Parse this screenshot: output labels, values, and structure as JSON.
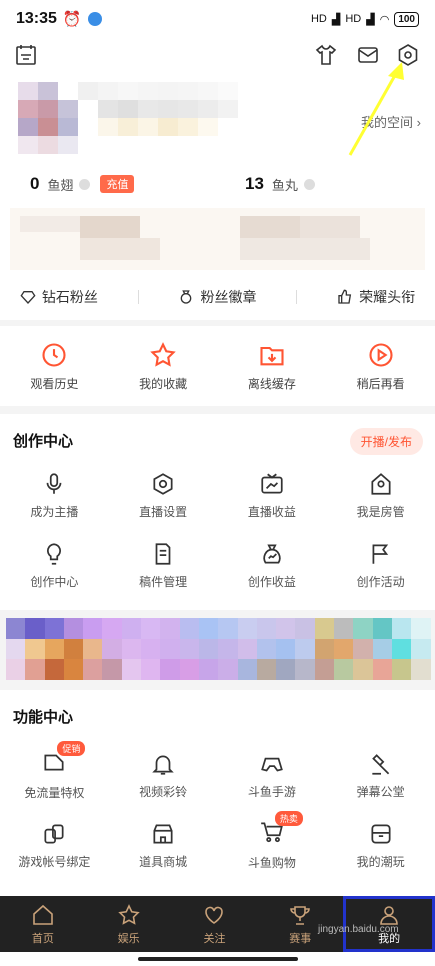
{
  "status": {
    "time": "13:35",
    "signal1": "HD",
    "signal2": "HD",
    "battery": "100"
  },
  "header": {
    "myspace": "我的空间"
  },
  "counts": {
    "yuchi_num": "0",
    "yuchi_label": "鱼翅",
    "recharge": "充值",
    "yuwan_num": "13",
    "yuwan_label": "鱼丸"
  },
  "fans": {
    "diamond": "钻石粉丝",
    "badge": "粉丝徽章",
    "honor": "荣耀头衔"
  },
  "quick": [
    {
      "label": "观看历史"
    },
    {
      "label": "我的收藏"
    },
    {
      "label": "离线缓存"
    },
    {
      "label": "稍后再看"
    }
  ],
  "creation": {
    "title": "创作中心",
    "live_button": "开播/发布",
    "items": [
      {
        "label": "成为主播"
      },
      {
        "label": "直播设置"
      },
      {
        "label": "直播收益"
      },
      {
        "label": "我是房管"
      },
      {
        "label": "创作中心"
      },
      {
        "label": "稿件管理"
      },
      {
        "label": "创作收益"
      },
      {
        "label": "创作活动"
      }
    ]
  },
  "features": {
    "title": "功能中心",
    "items": [
      {
        "label": "免流量特权",
        "badge": "促销"
      },
      {
        "label": "视频彩铃"
      },
      {
        "label": "斗鱼手游"
      },
      {
        "label": "弹幕公堂"
      },
      {
        "label": "游戏帐号绑定"
      },
      {
        "label": "道具商城"
      },
      {
        "label": "斗鱼购物",
        "badge": "热卖"
      },
      {
        "label": "我的潮玩"
      }
    ]
  },
  "tabs": [
    {
      "label": "首页"
    },
    {
      "label": "娱乐"
    },
    {
      "label": "关注"
    },
    {
      "label": "赛事"
    },
    {
      "label": "我的"
    }
  ],
  "watermark": "jingyan.baidu.com",
  "colors": {
    "accent": "#ff5533",
    "tabbar": "#222222",
    "tab_icon": "#c9a27a",
    "highlight": "#2233cc",
    "arrow": "#ffff33"
  }
}
